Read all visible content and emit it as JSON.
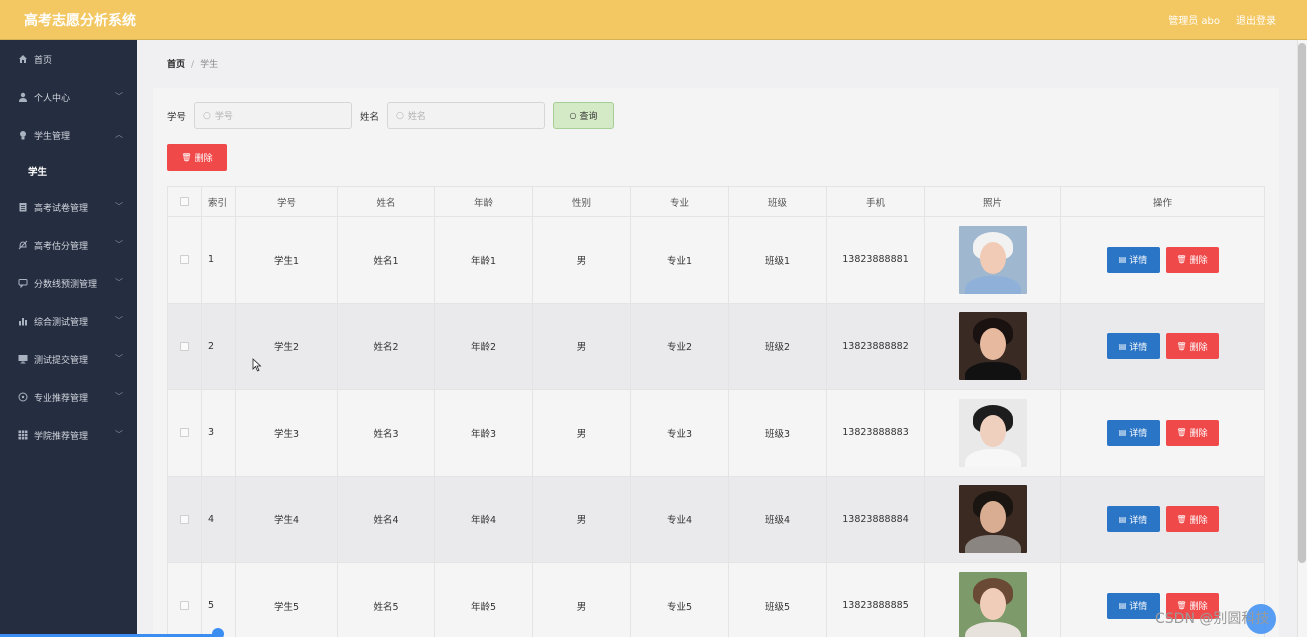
{
  "header": {
    "title": "高考志愿分析系统",
    "user_label": "管理员 abo",
    "logout_label": "退出登录"
  },
  "sidebar": {
    "items": [
      {
        "label": "首页",
        "icon": "home-icon",
        "expandable": false
      },
      {
        "label": "个人中心",
        "icon": "user-icon",
        "expandable": true
      },
      {
        "label": "学生管理",
        "icon": "bulb-icon",
        "expandable": true,
        "expanded": true,
        "children": [
          {
            "label": "学生"
          }
        ]
      },
      {
        "label": "高考试卷管理",
        "icon": "clipboard-icon",
        "expandable": true
      },
      {
        "label": "高考估分管理",
        "icon": "bell-off-icon",
        "expandable": true
      },
      {
        "label": "分数线预测管理",
        "icon": "chat-icon",
        "expandable": true
      },
      {
        "label": "综合测试管理",
        "icon": "bar-chart-icon",
        "expandable": true
      },
      {
        "label": "测试提交管理",
        "icon": "monitor-icon",
        "expandable": true
      },
      {
        "label": "专业推荐管理",
        "icon": "compass-icon",
        "expandable": true
      },
      {
        "label": "学院推荐管理",
        "icon": "grid-icon",
        "expandable": true
      }
    ]
  },
  "breadcrumb": {
    "home": "首页",
    "separator": "/",
    "current": "学生"
  },
  "search": {
    "label_xuehao": "学号",
    "placeholder_xuehao": "学号",
    "label_xingming": "姓名",
    "placeholder_xingming": "姓名",
    "search_button": "查询"
  },
  "toolbar": {
    "delete_label": "删除"
  },
  "table": {
    "columns": [
      "",
      "索引",
      "学号",
      "姓名",
      "年龄",
      "性别",
      "专业",
      "班级",
      "手机",
      "照片",
      "操作"
    ],
    "detail_label": "详情",
    "delete_label": "删除",
    "rows": [
      {
        "index": "1",
        "xuehao": "学生1",
        "xingming": "姓名1",
        "nianling": "年龄1",
        "xingbie": "男",
        "zhuanye": "专业1",
        "banji": "班级1",
        "shouji": "13823888881"
      },
      {
        "index": "2",
        "xuehao": "学生2",
        "xingming": "姓名2",
        "nianling": "年龄2",
        "xingbie": "男",
        "zhuanye": "专业2",
        "banji": "班级2",
        "shouji": "13823888882"
      },
      {
        "index": "3",
        "xuehao": "学生3",
        "xingming": "姓名3",
        "nianling": "年龄3",
        "xingbie": "男",
        "zhuanye": "专业3",
        "banji": "班级3",
        "shouji": "13823888883"
      },
      {
        "index": "4",
        "xuehao": "学生4",
        "xingming": "姓名4",
        "nianling": "年龄4",
        "xingbie": "男",
        "zhuanye": "专业4",
        "banji": "班级4",
        "shouji": "13823888884"
      },
      {
        "index": "5",
        "xuehao": "学生5",
        "xingming": "姓名5",
        "nianling": "年龄5",
        "xingbie": "男",
        "zhuanye": "专业5",
        "banji": "班级5",
        "shouji": "13823888885"
      }
    ]
  },
  "watermark": "CSDN @别圆科技",
  "colors": {
    "header_bg": "#f3c761",
    "sidebar_bg": "#252d40",
    "detail_button": "#2b75c6",
    "delete_button": "#f0494a",
    "search_button_bg": "#d4e9c6"
  }
}
